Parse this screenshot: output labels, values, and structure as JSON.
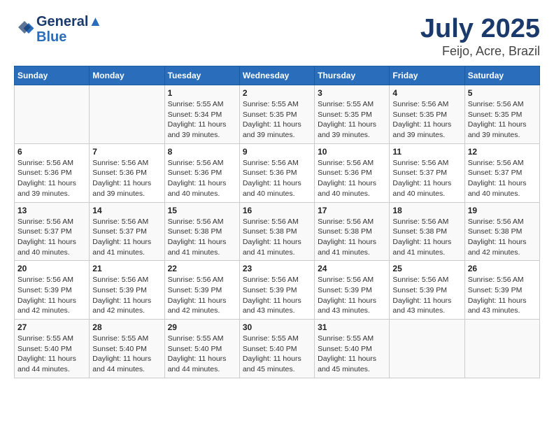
{
  "header": {
    "logo_line1": "General",
    "logo_line2": "Blue",
    "title": "July 2025",
    "subtitle": "Feijo, Acre, Brazil"
  },
  "columns": [
    "Sunday",
    "Monday",
    "Tuesday",
    "Wednesday",
    "Thursday",
    "Friday",
    "Saturday"
  ],
  "weeks": [
    [
      {
        "day": "",
        "info": ""
      },
      {
        "day": "",
        "info": ""
      },
      {
        "day": "1",
        "info": "Sunrise: 5:55 AM\nSunset: 5:34 PM\nDaylight: 11 hours and 39 minutes."
      },
      {
        "day": "2",
        "info": "Sunrise: 5:55 AM\nSunset: 5:35 PM\nDaylight: 11 hours and 39 minutes."
      },
      {
        "day": "3",
        "info": "Sunrise: 5:55 AM\nSunset: 5:35 PM\nDaylight: 11 hours and 39 minutes."
      },
      {
        "day": "4",
        "info": "Sunrise: 5:56 AM\nSunset: 5:35 PM\nDaylight: 11 hours and 39 minutes."
      },
      {
        "day": "5",
        "info": "Sunrise: 5:56 AM\nSunset: 5:35 PM\nDaylight: 11 hours and 39 minutes."
      }
    ],
    [
      {
        "day": "6",
        "info": "Sunrise: 5:56 AM\nSunset: 5:36 PM\nDaylight: 11 hours and 39 minutes."
      },
      {
        "day": "7",
        "info": "Sunrise: 5:56 AM\nSunset: 5:36 PM\nDaylight: 11 hours and 39 minutes."
      },
      {
        "day": "8",
        "info": "Sunrise: 5:56 AM\nSunset: 5:36 PM\nDaylight: 11 hours and 40 minutes."
      },
      {
        "day": "9",
        "info": "Sunrise: 5:56 AM\nSunset: 5:36 PM\nDaylight: 11 hours and 40 minutes."
      },
      {
        "day": "10",
        "info": "Sunrise: 5:56 AM\nSunset: 5:36 PM\nDaylight: 11 hours and 40 minutes."
      },
      {
        "day": "11",
        "info": "Sunrise: 5:56 AM\nSunset: 5:37 PM\nDaylight: 11 hours and 40 minutes."
      },
      {
        "day": "12",
        "info": "Sunrise: 5:56 AM\nSunset: 5:37 PM\nDaylight: 11 hours and 40 minutes."
      }
    ],
    [
      {
        "day": "13",
        "info": "Sunrise: 5:56 AM\nSunset: 5:37 PM\nDaylight: 11 hours and 40 minutes."
      },
      {
        "day": "14",
        "info": "Sunrise: 5:56 AM\nSunset: 5:37 PM\nDaylight: 11 hours and 41 minutes."
      },
      {
        "day": "15",
        "info": "Sunrise: 5:56 AM\nSunset: 5:38 PM\nDaylight: 11 hours and 41 minutes."
      },
      {
        "day": "16",
        "info": "Sunrise: 5:56 AM\nSunset: 5:38 PM\nDaylight: 11 hours and 41 minutes."
      },
      {
        "day": "17",
        "info": "Sunrise: 5:56 AM\nSunset: 5:38 PM\nDaylight: 11 hours and 41 minutes."
      },
      {
        "day": "18",
        "info": "Sunrise: 5:56 AM\nSunset: 5:38 PM\nDaylight: 11 hours and 41 minutes."
      },
      {
        "day": "19",
        "info": "Sunrise: 5:56 AM\nSunset: 5:38 PM\nDaylight: 11 hours and 42 minutes."
      }
    ],
    [
      {
        "day": "20",
        "info": "Sunrise: 5:56 AM\nSunset: 5:39 PM\nDaylight: 11 hours and 42 minutes."
      },
      {
        "day": "21",
        "info": "Sunrise: 5:56 AM\nSunset: 5:39 PM\nDaylight: 11 hours and 42 minutes."
      },
      {
        "day": "22",
        "info": "Sunrise: 5:56 AM\nSunset: 5:39 PM\nDaylight: 11 hours and 42 minutes."
      },
      {
        "day": "23",
        "info": "Sunrise: 5:56 AM\nSunset: 5:39 PM\nDaylight: 11 hours and 43 minutes."
      },
      {
        "day": "24",
        "info": "Sunrise: 5:56 AM\nSunset: 5:39 PM\nDaylight: 11 hours and 43 minutes."
      },
      {
        "day": "25",
        "info": "Sunrise: 5:56 AM\nSunset: 5:39 PM\nDaylight: 11 hours and 43 minutes."
      },
      {
        "day": "26",
        "info": "Sunrise: 5:56 AM\nSunset: 5:39 PM\nDaylight: 11 hours and 43 minutes."
      }
    ],
    [
      {
        "day": "27",
        "info": "Sunrise: 5:55 AM\nSunset: 5:40 PM\nDaylight: 11 hours and 44 minutes."
      },
      {
        "day": "28",
        "info": "Sunrise: 5:55 AM\nSunset: 5:40 PM\nDaylight: 11 hours and 44 minutes."
      },
      {
        "day": "29",
        "info": "Sunrise: 5:55 AM\nSunset: 5:40 PM\nDaylight: 11 hours and 44 minutes."
      },
      {
        "day": "30",
        "info": "Sunrise: 5:55 AM\nSunset: 5:40 PM\nDaylight: 11 hours and 45 minutes."
      },
      {
        "day": "31",
        "info": "Sunrise: 5:55 AM\nSunset: 5:40 PM\nDaylight: 11 hours and 45 minutes."
      },
      {
        "day": "",
        "info": ""
      },
      {
        "day": "",
        "info": ""
      }
    ]
  ]
}
